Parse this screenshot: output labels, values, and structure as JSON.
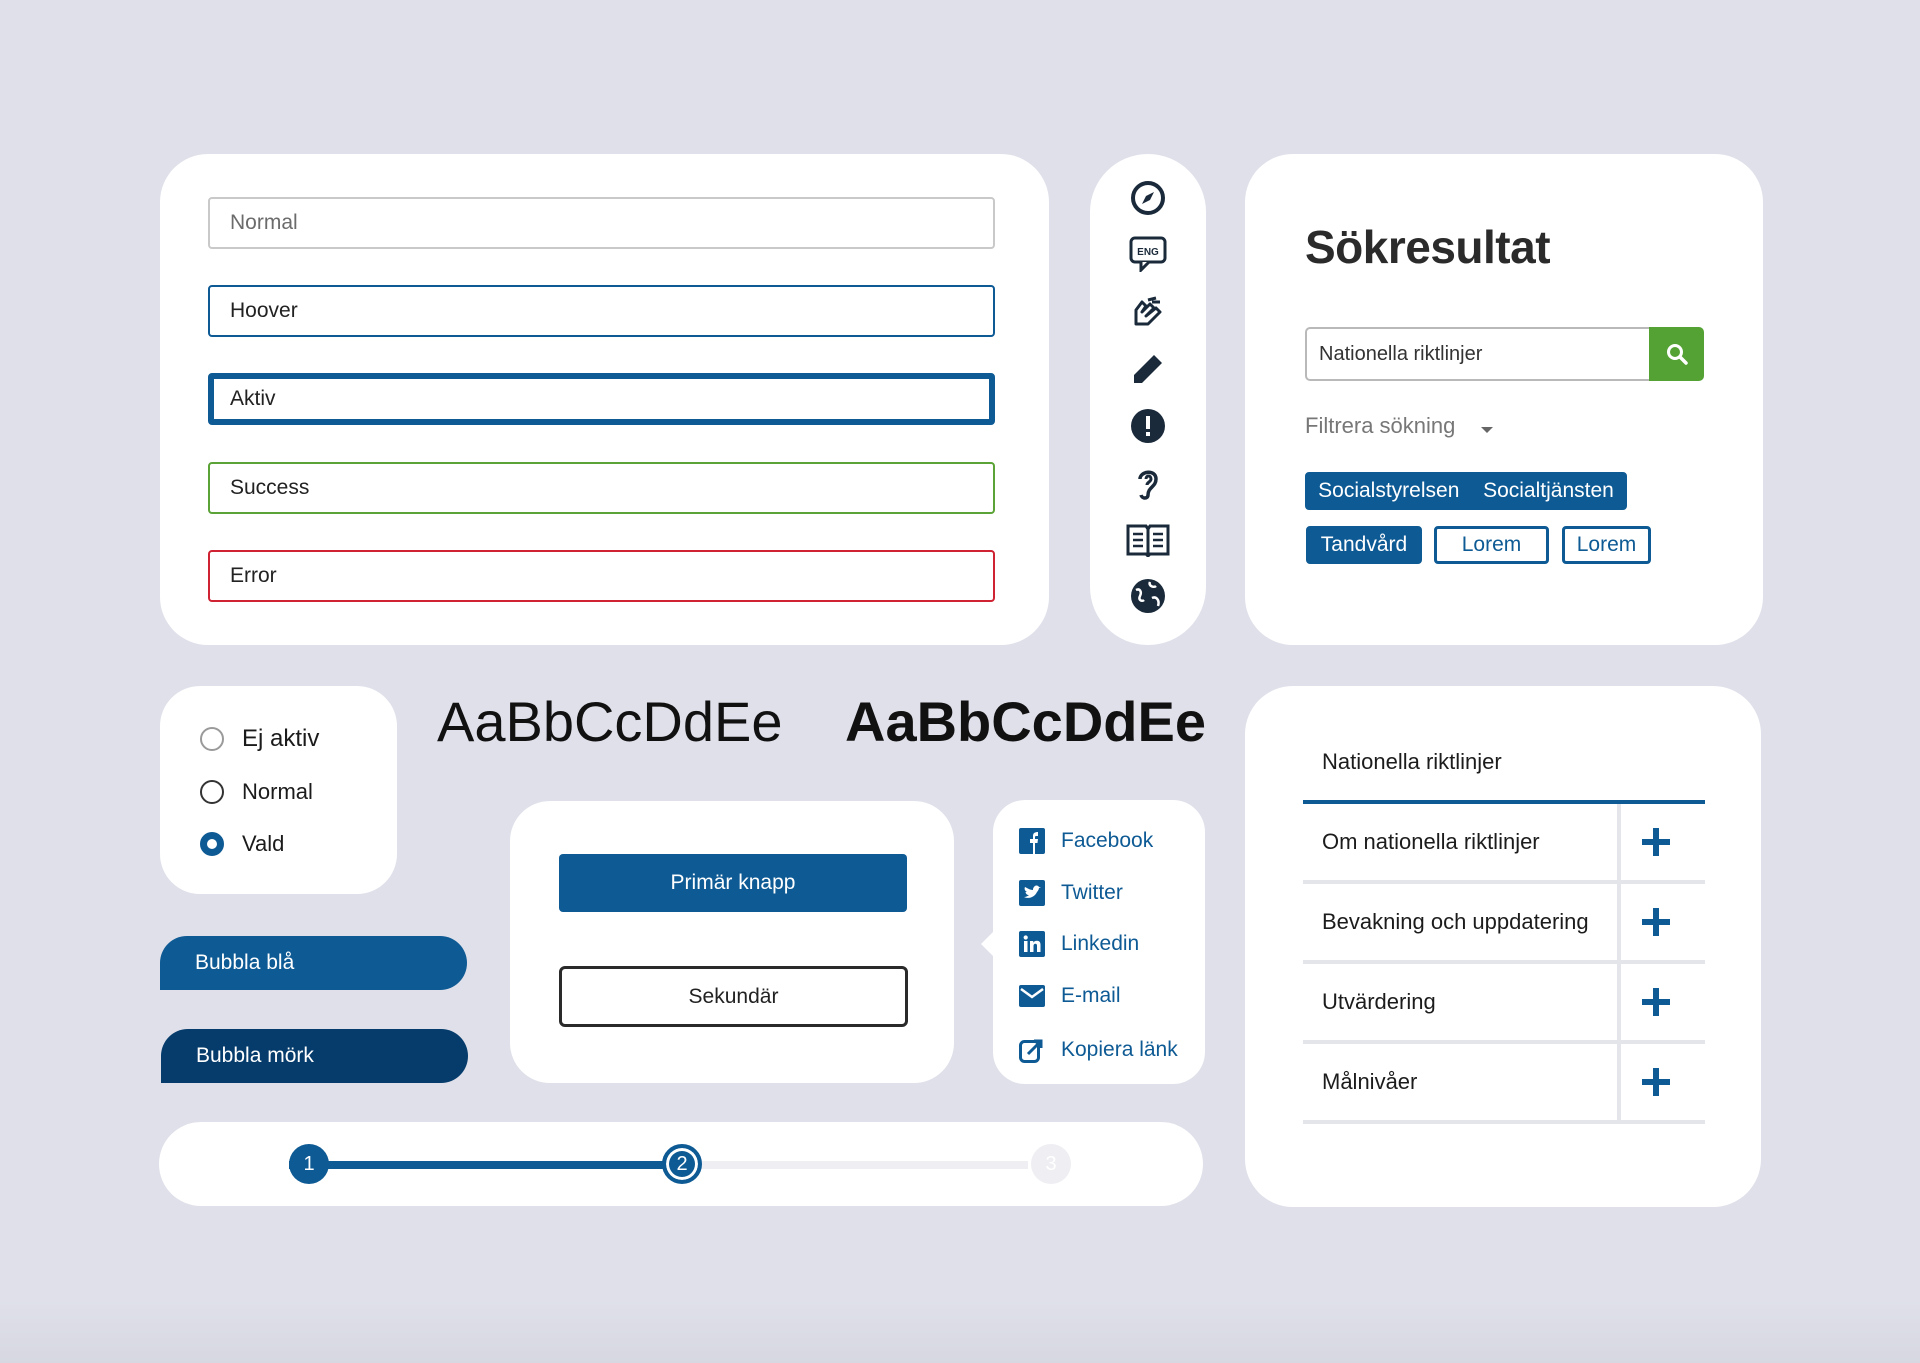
{
  "inputs": {
    "normal": "Normal",
    "hover": "Hoover",
    "active": "Aktiv",
    "success": "Success",
    "error": "Error"
  },
  "icons": [
    "compass-icon",
    "eng-speech-icon",
    "sign-language-icon",
    "pencil-icon",
    "alert-icon",
    "ear-icon",
    "book-icon",
    "globe-icon"
  ],
  "icon_labels": {
    "eng": "ENG"
  },
  "search": {
    "title": "Sökresultat",
    "query": "Nationella riktlinjer",
    "filter_label": "Filtrera sökning",
    "chips_row1": [
      "Socialstyrelsen",
      "Socialtjänsten"
    ],
    "chips_row2": [
      "Tandvård",
      "Lorem",
      "Lorem"
    ]
  },
  "radios": [
    {
      "label": "Ej aktiv",
      "state": "disabled"
    },
    {
      "label": "Normal",
      "state": "normal"
    },
    {
      "label": "Vald",
      "state": "selected"
    }
  ],
  "typography": {
    "regular": "AaBbCcDdEe",
    "bold": "AaBbCcDdEe"
  },
  "bubbles": {
    "blue": "Bubbla blå",
    "dark": "Bubbla mörk"
  },
  "buttons": {
    "primary": "Primär knapp",
    "secondary": "Sekundär"
  },
  "share": [
    {
      "label": "Facebook",
      "icon": "facebook-icon"
    },
    {
      "label": "Twitter",
      "icon": "twitter-icon"
    },
    {
      "label": "Linkedin",
      "icon": "linkedin-icon"
    },
    {
      "label": "E-mail",
      "icon": "email-icon"
    },
    {
      "label": "Kopiera länk",
      "icon": "copy-link-icon"
    }
  ],
  "stepper": {
    "steps": [
      "1",
      "2",
      "3"
    ],
    "current": 2
  },
  "accordion": {
    "title": "Nationella riktlinjer",
    "items": [
      "Om nationella riktlinjer",
      "Bevakning och uppdatering",
      "Utvärdering",
      "Målnivåer"
    ]
  },
  "colors": {
    "primary_blue": "#0e5a94",
    "dark_blue": "#063c6b",
    "success_green": "#5ba336",
    "search_green": "#55a234",
    "error_red": "#cf2232",
    "background": "#dfe0ea"
  }
}
